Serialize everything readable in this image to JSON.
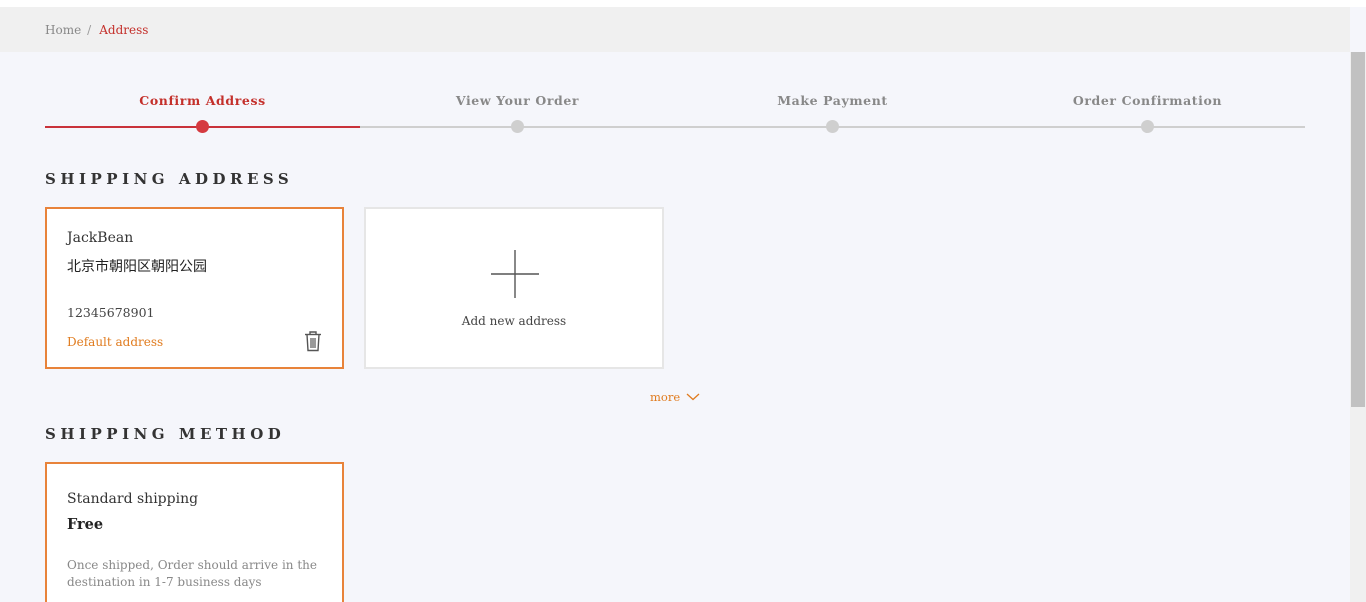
{
  "breadcrumb": {
    "home": "Home",
    "separator": "/",
    "current": "Address"
  },
  "steps": [
    {
      "label": "Confirm Address",
      "active": true
    },
    {
      "label": "View Your Order",
      "active": false
    },
    {
      "label": "Make Payment",
      "active": false
    },
    {
      "label": "Order Confirmation",
      "active": false
    }
  ],
  "shipping_address": {
    "title": "SHIPPING ADDRESS",
    "card": {
      "name": "JackBean",
      "street": "北京市朝阳区朝阳公园",
      "phone": "12345678901",
      "default_label": "Default address",
      "delete_icon": "trash-icon"
    },
    "add_label": "Add new address",
    "add_icon": "plus-icon",
    "more_label": "more",
    "more_icon": "chevron-down-icon"
  },
  "shipping_method": {
    "title": "SHIPPING METHOD",
    "card": {
      "name": "Standard shipping",
      "price": "Free",
      "description": "Once shipped, Order should arrive in the destination in 1-7 business days"
    }
  },
  "colors": {
    "accent": "#c4302b",
    "orange": "#e8833a",
    "background": "#f5f6fb"
  }
}
